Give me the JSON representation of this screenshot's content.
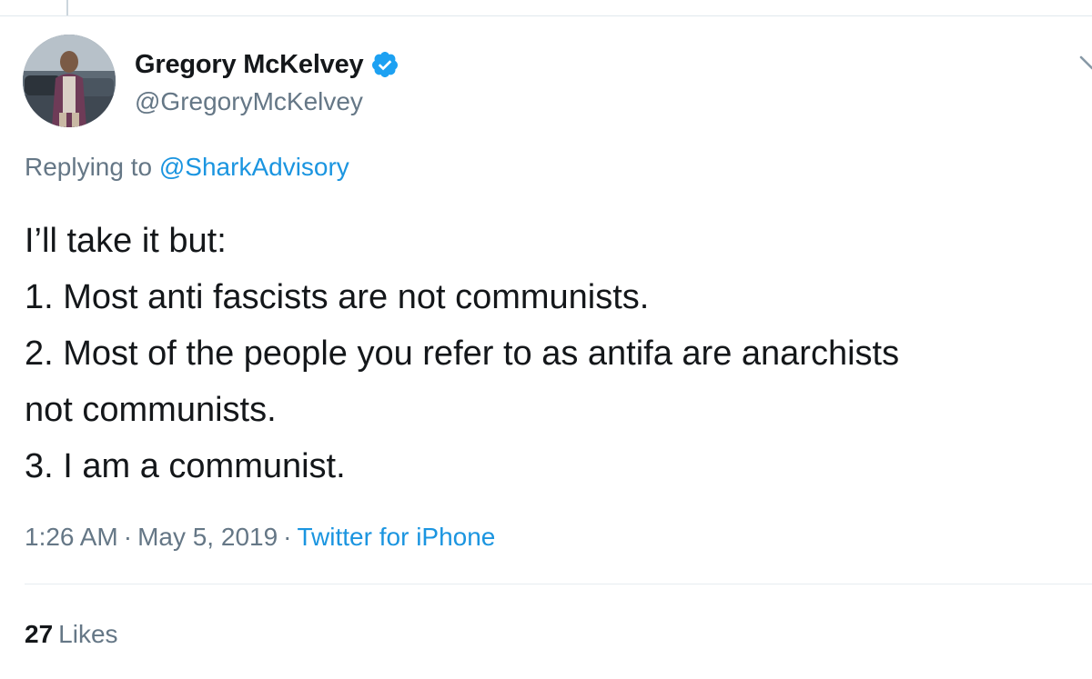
{
  "author": {
    "display_name": "Gregory McKelvey",
    "handle": "@GregoryMcKelvey",
    "verified": true,
    "avatar_icon": "profile-photo"
  },
  "reply": {
    "prefix": "Replying to",
    "mention": "@SharkAdvisory"
  },
  "tweet": {
    "lines": [
      "I’ll take it but:",
      "1. Most anti fascists are not communists.",
      "2. Most of the people you refer to as antifa are anarchists",
      "not communists.",
      "3. I am a communist."
    ]
  },
  "meta": {
    "time": "1:26 AM",
    "date": "May 5, 2019",
    "separator": "·",
    "source": "Twitter for iPhone"
  },
  "stats": {
    "likes_count": "27",
    "likes_label": "Likes"
  },
  "colors": {
    "accent": "#1b95e0",
    "verified_badge": "#1da1f2",
    "secondary_text": "#657786",
    "primary_text": "#14171a",
    "divider": "#e6ecf0"
  }
}
